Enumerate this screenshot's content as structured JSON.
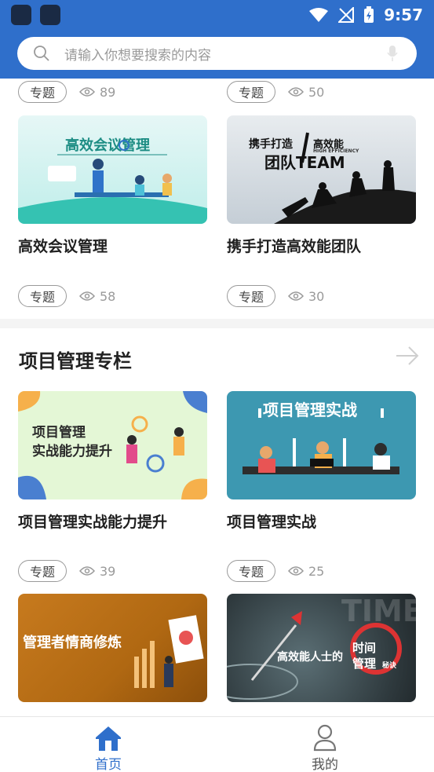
{
  "status_bar": {
    "time": "9:57"
  },
  "search": {
    "placeholder": "请输入你想要搜索的内容"
  },
  "top_row": [
    {
      "tag": "专题",
      "views": "89"
    },
    {
      "tag": "专题",
      "views": "50"
    }
  ],
  "cards_row1": [
    {
      "title": "高效会议管理",
      "image_text": "高效会议管理",
      "tag": "专题",
      "views": "58"
    },
    {
      "title": "携手打造高效能团队",
      "image_text_1": "携手打造",
      "image_text_2": "高效能",
      "image_text_3": "团队TEAM",
      "image_text_small": "HIGH EFFICIENCY",
      "tag": "专题",
      "views": "30"
    }
  ],
  "section": {
    "title": "项目管理专栏"
  },
  "cards_row2": [
    {
      "title": "项目管理实战能力提升",
      "image_text_1": "项目管理",
      "image_text_2": "实战能力提升",
      "tag": "专题",
      "views": "39"
    },
    {
      "title": "项目管理实战",
      "image_text": "项目管理实战",
      "tag": "专题",
      "views": "25"
    }
  ],
  "cards_row3": [
    {
      "image_text": "管理者情商修炼"
    },
    {
      "image_text_1": "高效能人士的",
      "image_text_2": "时间",
      "image_text_3": "管理",
      "image_text_4": "秘诀",
      "image_text_bg": "TIME"
    }
  ],
  "bottom_nav": [
    {
      "label": "首页",
      "active": true
    },
    {
      "label": "我的",
      "active": false
    }
  ],
  "colors": {
    "primary": "#2f6fcb",
    "active_nav": "#2f6fcb",
    "inactive_nav": "#555555"
  }
}
